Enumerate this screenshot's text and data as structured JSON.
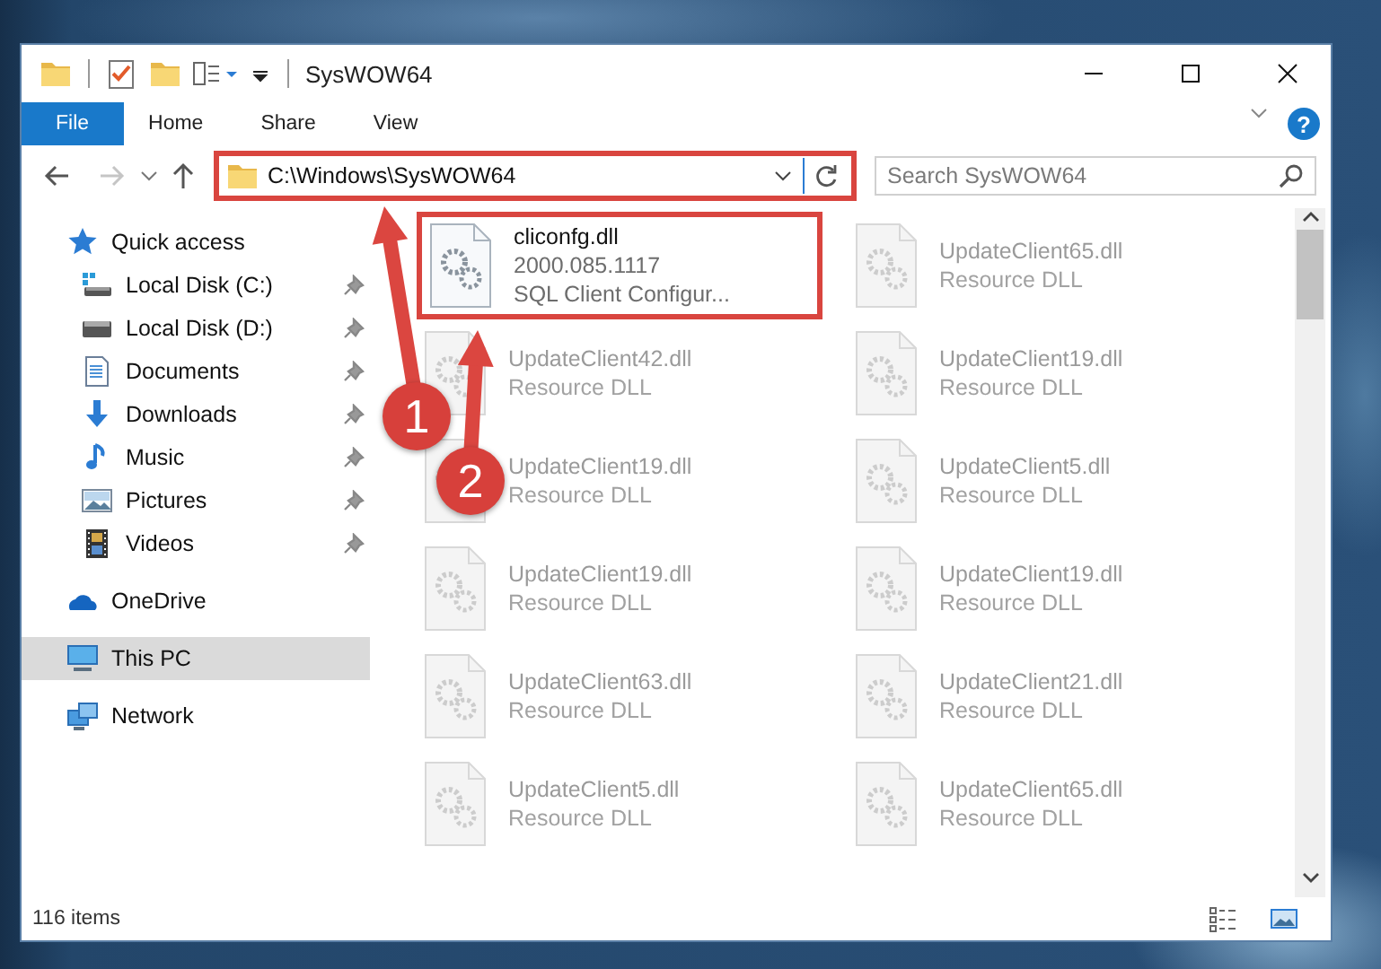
{
  "window": {
    "title": "SysWOW64"
  },
  "ribbon": {
    "tabs": [
      {
        "label": "File",
        "selected": true
      },
      {
        "label": "Home",
        "selected": false
      },
      {
        "label": "Share",
        "selected": false
      },
      {
        "label": "View",
        "selected": false
      }
    ],
    "help": "?"
  },
  "address_bar": {
    "path": "C:\\Windows\\SysWOW64",
    "highlighted": true
  },
  "search": {
    "placeholder": "Search SysWOW64"
  },
  "navigation": [
    {
      "label": "Quick access",
      "kind": "quick-access",
      "selected": false,
      "children": [
        {
          "label": "Local Disk (C:)",
          "kind": "system-drive",
          "pinned": true,
          "selected": false
        },
        {
          "label": "Local Disk (D:)",
          "kind": "drive",
          "pinned": true,
          "selected": false
        },
        {
          "label": "Documents",
          "kind": "documents",
          "pinned": true,
          "selected": false
        },
        {
          "label": "Downloads",
          "kind": "downloads",
          "pinned": true,
          "selected": false
        },
        {
          "label": "Music",
          "kind": "music",
          "pinned": true,
          "selected": false
        },
        {
          "label": "Pictures",
          "kind": "pictures",
          "pinned": true,
          "selected": false
        },
        {
          "label": "Videos",
          "kind": "videos",
          "pinned": true,
          "selected": false
        }
      ]
    },
    {
      "label": "OneDrive",
      "kind": "cloud",
      "selected": false
    },
    {
      "label": "This PC",
      "kind": "computer",
      "selected": true
    },
    {
      "label": "Network",
      "kind": "network",
      "selected": false
    }
  ],
  "files": [
    {
      "name": "cliconfg.dll",
      "details": [
        "2000.085.1117",
        "SQL Client Configur..."
      ],
      "faded": false,
      "highlighted": true
    },
    {
      "name": "UpdateClient65.dll",
      "details": [
        "Resource DLL"
      ],
      "faded": true,
      "highlighted": false
    },
    {
      "name": "UpdateClient42.dll",
      "details": [
        "Resource DLL"
      ],
      "faded": true,
      "highlighted": false
    },
    {
      "name": "UpdateClient19.dll",
      "details": [
        "Resource DLL"
      ],
      "faded": true,
      "highlighted": false
    },
    {
      "name": "UpdateClient19.dll",
      "details": [
        "Resource DLL"
      ],
      "faded": true,
      "highlighted": false
    },
    {
      "name": "UpdateClient5.dll",
      "details": [
        "Resource DLL"
      ],
      "faded": true,
      "highlighted": false
    },
    {
      "name": "UpdateClient19.dll",
      "details": [
        "Resource DLL"
      ],
      "faded": true,
      "highlighted": false
    },
    {
      "name": "UpdateClient19.dll",
      "details": [
        "Resource DLL"
      ],
      "faded": true,
      "highlighted": false
    },
    {
      "name": "UpdateClient63.dll",
      "details": [
        "Resource DLL"
      ],
      "faded": true,
      "highlighted": false
    },
    {
      "name": "UpdateClient21.dll",
      "details": [
        "Resource DLL"
      ],
      "faded": true,
      "highlighted": false
    },
    {
      "name": "UpdateClient5.dll",
      "details": [
        "Resource DLL"
      ],
      "faded": true,
      "highlighted": false
    },
    {
      "name": "UpdateClient65.dll",
      "details": [
        "Resource DLL"
      ],
      "faded": true,
      "highlighted": false
    }
  ],
  "status_bar": {
    "item_count": "116 items"
  },
  "callouts": [
    {
      "number": "1"
    },
    {
      "number": "2"
    }
  ]
}
